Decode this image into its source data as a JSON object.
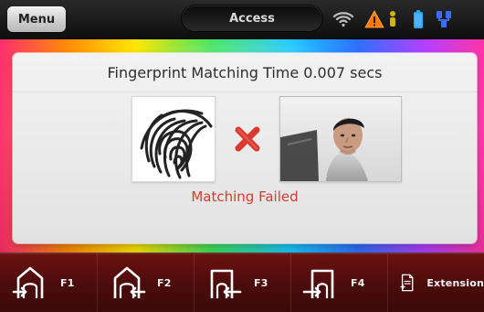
{
  "topbar": {
    "menu_label": "Menu",
    "title": "Access",
    "status_icons": [
      "wifi-icon",
      "warning-icon",
      "person-icon",
      "battery-icon",
      "network-icon"
    ],
    "colors": {
      "warning": "#ff7a00",
      "person": "#d6b300",
      "battery": "#2aa8ff",
      "network": "#3b6cff"
    }
  },
  "panel": {
    "header_text": "Fingerprint Matching Time 0.007 secs",
    "status_text": "Matching Failed",
    "status_color": "#d63b2e"
  },
  "function_bar": {
    "buttons": [
      {
        "label": "F1",
        "icon": "door-enter-up-icon"
      },
      {
        "label": "F2",
        "icon": "door-exit-up-icon"
      },
      {
        "label": "F3",
        "icon": "door-exit-icon"
      },
      {
        "label": "F4",
        "icon": "door-enter-icon"
      },
      {
        "label": "Extension",
        "icon": "document-plus-icon"
      }
    ]
  }
}
